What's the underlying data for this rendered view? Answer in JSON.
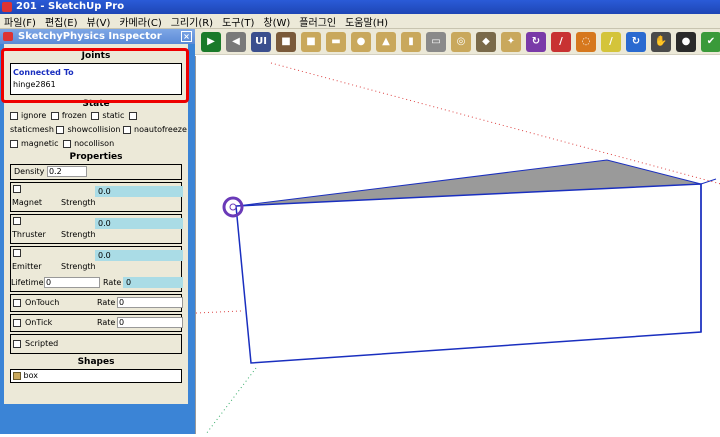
{
  "window": {
    "title": "201 - SketchUp Pro"
  },
  "menu": [
    "파일(F)",
    "편집(E)",
    "뷰(V)",
    "카메라(C)",
    "그리기(R)",
    "도구(T)",
    "창(W)",
    "플러그인",
    "도움말(H)"
  ],
  "toolbar": {
    "buttons": [
      {
        "name": "play-icon",
        "color": "#1a7a2a",
        "glyph": "▶"
      },
      {
        "name": "rewind-icon",
        "color": "#7a7a7a",
        "glyph": "◀"
      },
      {
        "name": "ui-icon",
        "color": "#3b4f8e",
        "glyph": "UI"
      },
      {
        "name": "objects-icon",
        "color": "#7a5a3a",
        "glyph": "■"
      },
      {
        "name": "box-shape-icon",
        "color": "#c9a85c",
        "glyph": "■"
      },
      {
        "name": "cylinder-shape-icon",
        "color": "#c9a85c",
        "glyph": "▬"
      },
      {
        "name": "sphere-shape-icon",
        "color": "#c9a85c",
        "glyph": "●"
      },
      {
        "name": "cone-shape-icon",
        "color": "#c9a85c",
        "glyph": "▲"
      },
      {
        "name": "capsule-shape-icon",
        "color": "#c9a85c",
        "glyph": "▮"
      },
      {
        "name": "plate-shape-icon",
        "color": "#8a8a8a",
        "glyph": "▭"
      },
      {
        "name": "torus-shape-icon",
        "color": "#c9a85c",
        "glyph": "◎"
      },
      {
        "name": "joint-tool-icon",
        "color": "#7a6a4a",
        "glyph": "◆"
      },
      {
        "name": "pin-tool-icon",
        "color": "#c9a85c",
        "glyph": "✦"
      },
      {
        "name": "rotate-purple-icon",
        "color": "#7a3aa8",
        "glyph": "↻"
      },
      {
        "name": "line-red-icon",
        "color": "#c83232",
        "glyph": "/"
      },
      {
        "name": "dashed-circle-icon",
        "color": "#d6781e",
        "glyph": "◌"
      },
      {
        "name": "pencil-yellow-icon",
        "color": "#d4c43a",
        "glyph": "/"
      },
      {
        "name": "refresh-blue-icon",
        "color": "#2a6ad0",
        "glyph": "↻"
      },
      {
        "name": "hand-icon",
        "color": "#4a4a4a",
        "glyph": "✋"
      },
      {
        "name": "black-dot-icon",
        "color": "#2a2a2a",
        "glyph": "●"
      },
      {
        "name": "green-leaf-icon",
        "color": "#3a9a3a",
        "glyph": "✔"
      }
    ]
  },
  "inspector": {
    "title": "SketchyPhysics Inspector",
    "joints_header": "Joints",
    "connected_to_label": "Connected To",
    "connected_to_value": "hinge2861",
    "state_header": "State",
    "state_options": [
      "ignore",
      "frozen",
      "static",
      "staticmesh",
      "showcollision",
      "noautofreeze",
      "magnetic",
      "nocollison"
    ],
    "properties_header": "Properties",
    "density_label": "Density",
    "density_value": "0.2",
    "magnet_label": "Magnet",
    "magnet_strength_label": "Strength",
    "magnet_strength_value": "0.0",
    "thruster_label": "Thruster",
    "thruster_strength_label": "Strength",
    "thruster_strength_value": "0.0",
    "emitter_label": "Emitter",
    "emitter_strength_label": "Strength",
    "emitter_strength_value": "0.0",
    "lifetime_label": "Lifetime",
    "lifetime_value": "0",
    "emitter_rate_label": "Rate",
    "emitter_rate_value": "0",
    "ontouch_label": "OnTouch",
    "ontouch_rate_label": "Rate",
    "ontouch_rate_value": "0",
    "ontick_label": "OnTick",
    "ontick_rate_label": "Rate",
    "ontick_rate_value": "0",
    "scripted_label": "Scripted",
    "shapes_header": "Shapes",
    "shape_value": "box"
  },
  "colors": {
    "accent_panel": "#3b84d6",
    "selection_edge": "#1a2fbf",
    "highlight_frame": "#e00000",
    "top_face": "#9a9a9a"
  }
}
